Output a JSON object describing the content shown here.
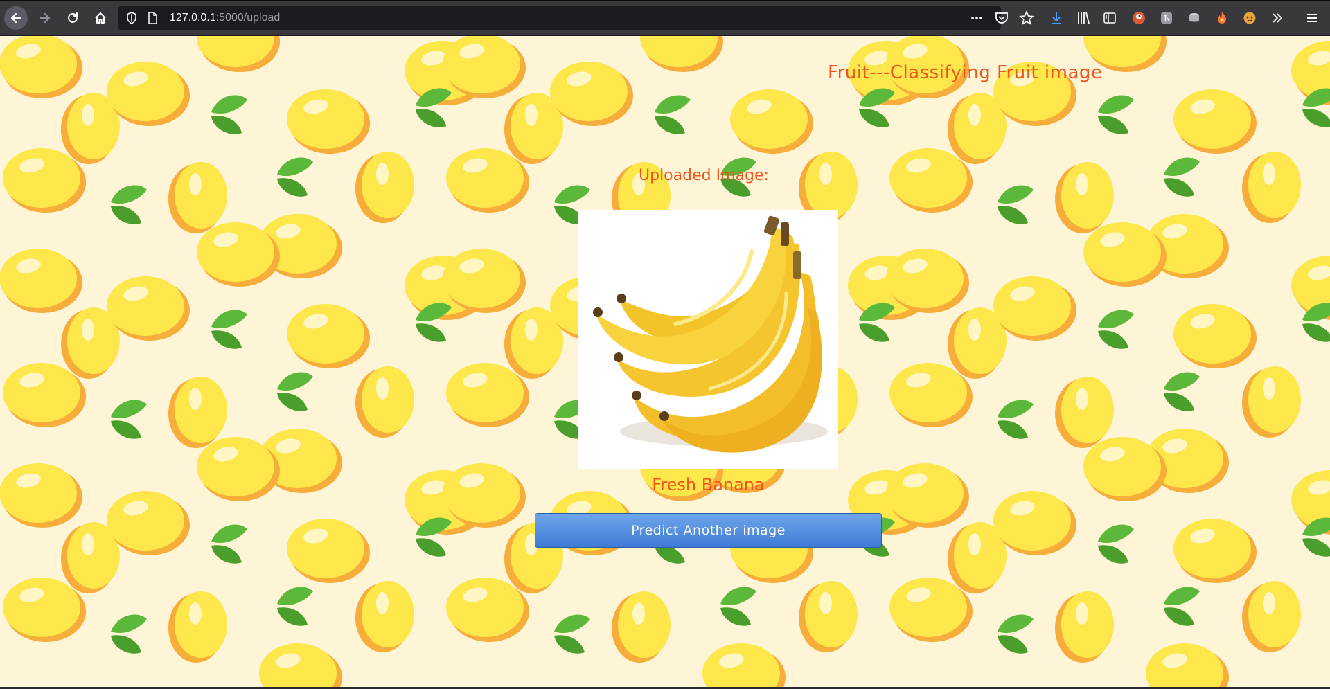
{
  "browser": {
    "url_host": "127.0.0.1",
    "url_path": ":5000/upload"
  },
  "page": {
    "title": "Fruit---Classifying Fruit image",
    "uploaded_label": "Uploaded Image:",
    "prediction": "Fresh Banana",
    "predict_button_label": "Predict Another image",
    "uploaded_image": "banana-bunch"
  },
  "colors": {
    "accent_text": "#f2551c",
    "page_background": "#fdf5d6",
    "lemon": "#fde74a",
    "leaf": "#5cb83a",
    "button": "#4f8be0"
  },
  "icons": [
    "back-icon",
    "forward-icon",
    "reload-icon",
    "home-icon",
    "shield-icon",
    "page-icon",
    "more-icon",
    "pocket-icon",
    "star-icon",
    "download-icon",
    "library-icon",
    "sidebar-icon",
    "extension-icon"
  ]
}
